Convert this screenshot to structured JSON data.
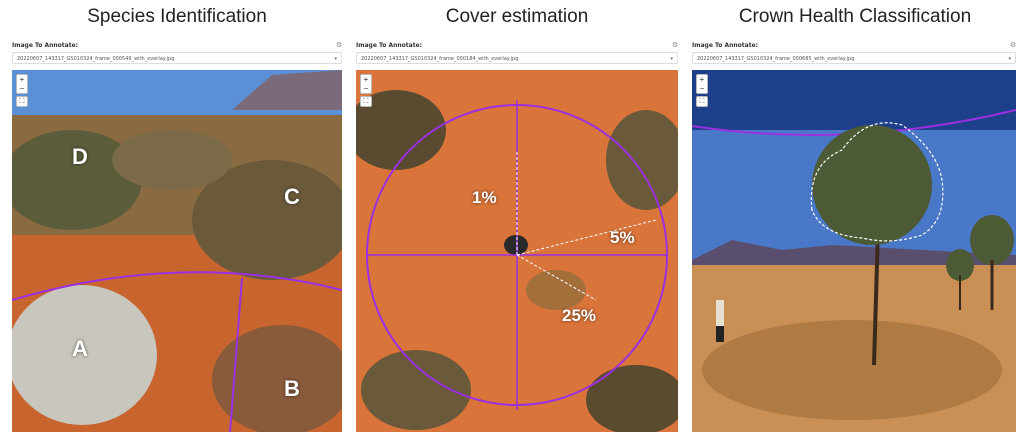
{
  "panels": [
    {
      "title": "Species Identification",
      "image_label": "Image To Annotate:",
      "selected_image": "20220607_143317_GS010324_frame_000549_with_overlay.jpg",
      "labels": [
        "A",
        "B",
        "C",
        "D"
      ]
    },
    {
      "title": "Cover estimation",
      "image_label": "Image To Annotate:",
      "selected_image": "20220607_143317_GS010324_frame_000184_with_overlay.jpg",
      "percent_labels": [
        "1%",
        "5%",
        "25%"
      ]
    },
    {
      "title": "Crown Health Classification",
      "image_label": "Image To Annotate:",
      "selected_image": "20220607_143317_GS010324_frame_000685_with_overlay.jpg"
    }
  ],
  "controls": {
    "zoom_in": "+",
    "zoom_out": "−",
    "fullscreen": "⛶",
    "settings_icon": "⚙",
    "caret": "▾"
  },
  "colors": {
    "overlay": "#9b30e0",
    "sand": "#d9743a",
    "sky": "#4a78c8"
  }
}
